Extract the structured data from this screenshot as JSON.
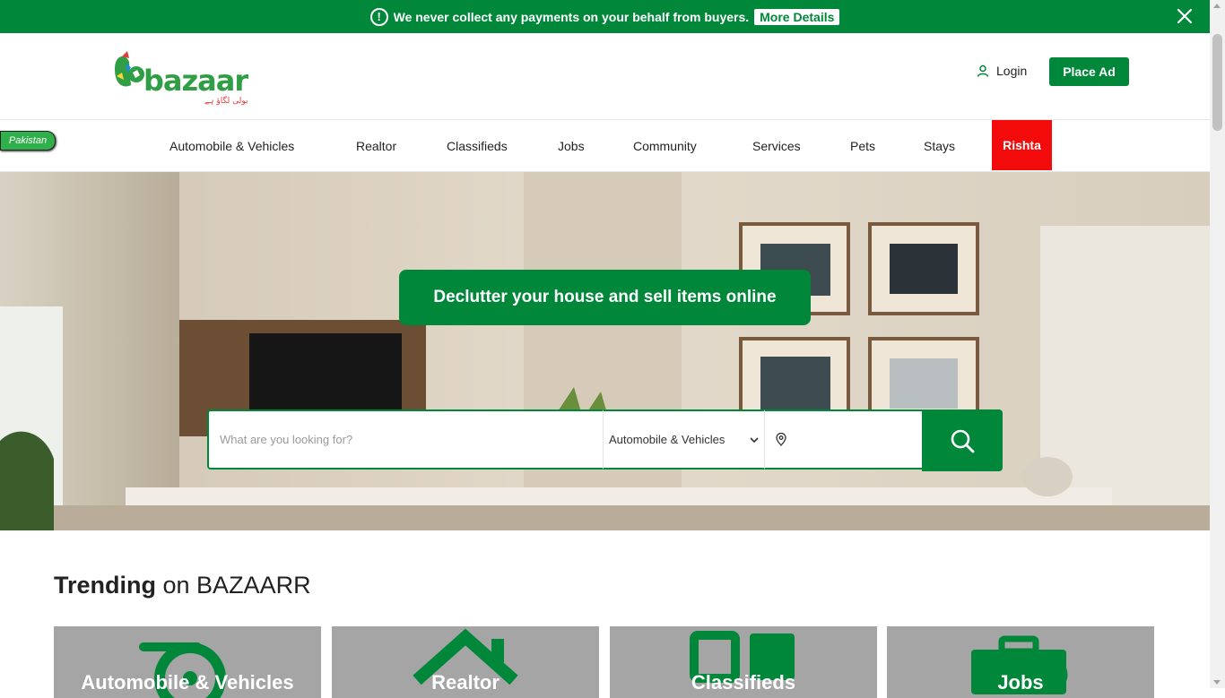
{
  "notice": {
    "message": "We never collect any payments on your behalf from buyers.",
    "more_details": "More Details",
    "icons": {
      "info": "info-circle-icon",
      "close": "close-icon"
    }
  },
  "header": {
    "logo_text": "bazaar",
    "logo_tagline": "بولی لگاؤ ہے",
    "login_label": "Login",
    "place_ad_label": "Place Ad"
  },
  "nav": {
    "country": "Pakistan",
    "items": [
      "Automobile & Vehicles",
      "Realtor",
      "Classifieds",
      "Jobs",
      "Community",
      "Services",
      "Pets",
      "Stays",
      "Rishta"
    ]
  },
  "hero": {
    "banner": "Declutter your house and sell items online",
    "search_placeholder": "What are you looking for?",
    "category_selected": "Automobile & Vehicles",
    "location_value": ""
  },
  "trending": {
    "title_bold": "Trending",
    "title_rest": "on BAZAARR",
    "cards": [
      "Automobile & Vehicles",
      "Realtor",
      "Classifieds",
      "Jobs"
    ]
  },
  "colors": {
    "brand_green": "#00873a",
    "rishta_red": "#f30b0b",
    "card_gray": "#a5a5a5"
  }
}
